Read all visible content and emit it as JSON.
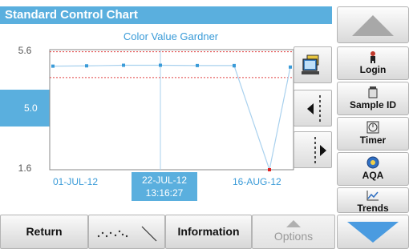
{
  "header": {
    "title": "Standard Control Chart"
  },
  "chart_data": {
    "type": "line",
    "title": "Color Value Gardner",
    "y_ticks": [
      "5.6",
      "5.0",
      "1.6"
    ],
    "y_current": "5.0",
    "ylim": [
      1.6,
      5.6
    ],
    "control_limits": {
      "upper": 5.53,
      "lower": 4.67
    },
    "x_labels": [
      "01-JUL-12",
      "16-AUG-12"
    ],
    "cursor_label": {
      "date": "22-JUL-12",
      "time": "13:16:27"
    },
    "series": [
      {
        "values": [
          5.05,
          5.06,
          5.08,
          5.08,
          5.07,
          5.07,
          5.06,
          1.6,
          5.02
        ]
      }
    ],
    "colors": {
      "line": "#a9d1ee",
      "point": "#3a9bd8",
      "limit": "#e04040",
      "outlier": "#e02020",
      "accent": "#5aafde"
    }
  },
  "bottom": {
    "return_label": "Return",
    "information_label": "Information",
    "options_label": "Options"
  },
  "sidebar": {
    "login_label": "Login",
    "sample_id_label": "Sample ID",
    "timer_label": "Timer",
    "aqa_label": "AQA",
    "trends_label": "Trends"
  }
}
